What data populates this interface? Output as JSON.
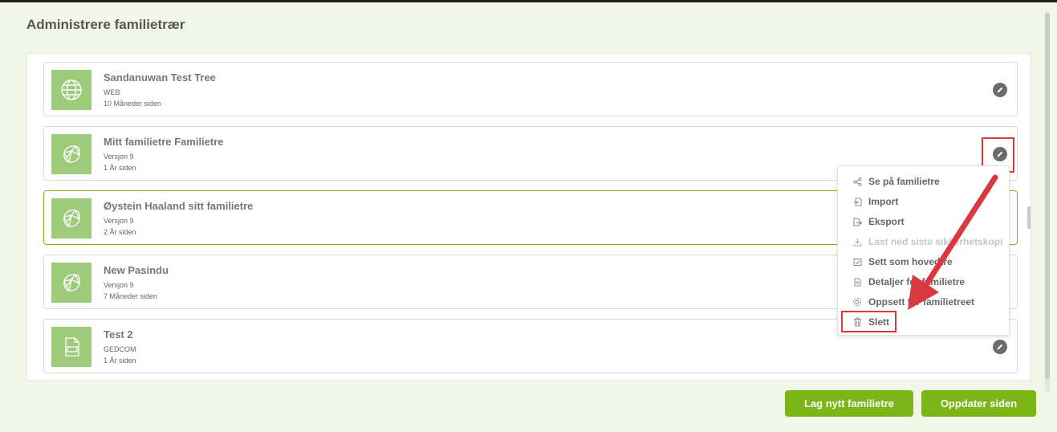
{
  "page": {
    "title": "Administrere familietrær"
  },
  "trees": [
    {
      "name": "Sandanuwan Test Tree",
      "source": "WEB",
      "updated": "10 Måneder siden",
      "icon": "globe-icon"
    },
    {
      "name": "Mitt familietre Familietre",
      "source": "Versjon 9",
      "updated": "1 År siden",
      "icon": "gem-icon"
    },
    {
      "name": "Øystein Haaland sitt familietre",
      "source": "Versjon 9",
      "updated": "2 År siden",
      "icon": "gem-icon"
    },
    {
      "name": "New Pasindu",
      "source": "Versjon 9",
      "updated": "7 Måneder siden",
      "icon": "gem-icon"
    },
    {
      "name": "Test 2",
      "source": "GEDCOM",
      "updated": "1 År siden",
      "icon": "gedcom-file-icon"
    }
  ],
  "menu": {
    "items": [
      {
        "label": "Se på familietre",
        "icon": "share-icon"
      },
      {
        "label": "Import",
        "icon": "import-icon"
      },
      {
        "label": "Eksport",
        "icon": "export-icon"
      },
      {
        "label": "Last ned siste sikkerhetskopi",
        "icon": "download-icon",
        "disabled": true
      },
      {
        "label": "Sett som hovedtre",
        "icon": "home-icon"
      },
      {
        "label": "Detaljer for familietre",
        "icon": "document-icon"
      },
      {
        "label": "Oppsett for familietreet",
        "icon": "gear-icon"
      },
      {
        "label": "Slett",
        "icon": "trash-icon"
      }
    ]
  },
  "buttons": {
    "new_tree": "Lag nytt familietre",
    "refresh": "Oppdater siden"
  },
  "colors": {
    "accent": "#7cb518",
    "thumb": "#9ccb7a",
    "annotation": "#d9393e"
  }
}
